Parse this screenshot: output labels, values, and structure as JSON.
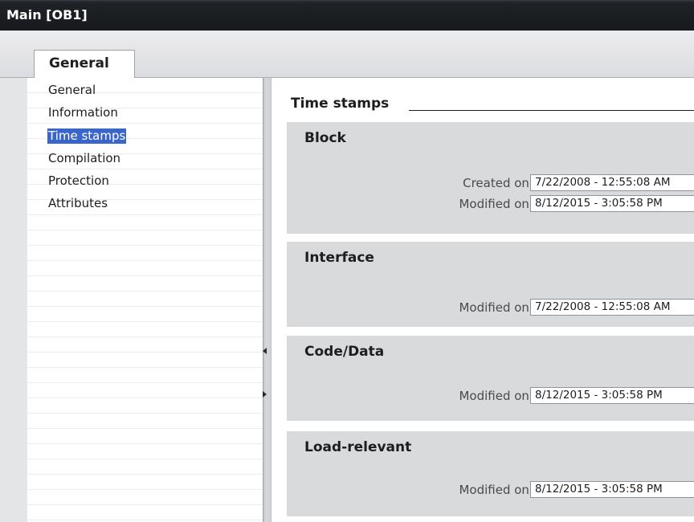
{
  "window": {
    "title": "Main [OB1]"
  },
  "tabs": [
    {
      "label": "General"
    }
  ],
  "nav": {
    "items": [
      {
        "label": "General"
      },
      {
        "label": "Information"
      },
      {
        "label": "Time stamps"
      },
      {
        "label": "Compilation"
      },
      {
        "label": "Protection"
      },
      {
        "label": "Attributes"
      }
    ],
    "selected": "Time stamps"
  },
  "content": {
    "title": "Time stamps",
    "groups": [
      {
        "title": "Block",
        "fields": [
          {
            "label": "Created on:",
            "value": "7/22/2008 - 12:55:08 AM"
          },
          {
            "label": "Modified on:",
            "value": "8/12/2015 - 3:05:58 PM"
          }
        ]
      },
      {
        "title": "Interface",
        "fields": [
          {
            "label": "Modified on:",
            "value": "7/22/2008 - 12:55:08 AM"
          }
        ]
      },
      {
        "title": "Code/Data",
        "fields": [
          {
            "label": "Modified on:",
            "value": "8/12/2015 - 3:05:58 PM"
          }
        ]
      },
      {
        "title": "Load-relevant",
        "fields": [
          {
            "label": "Modified on:",
            "value": "8/12/2015 - 3:05:58 PM"
          }
        ]
      }
    ]
  },
  "colors": {
    "selection": "#3b66c9",
    "titlebar": "#17191c",
    "group_bg": "#d9dadc"
  }
}
